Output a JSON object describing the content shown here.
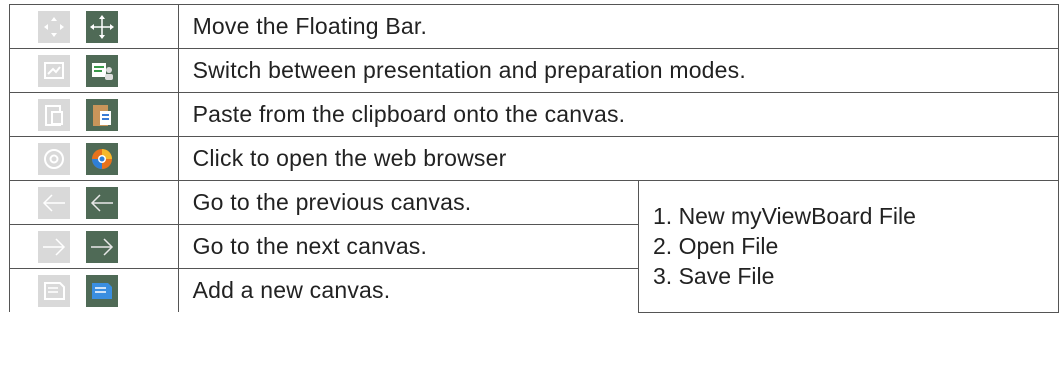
{
  "rows": [
    {
      "text": "Move the Floating Bar.",
      "icon_inactive": "move-icon-inactive",
      "icon_active": "move-icon-active"
    },
    {
      "text": "Switch between presentation and preparation modes.",
      "icon_inactive": "mode-switch-icon-inactive",
      "icon_active": "mode-switch-icon-active"
    },
    {
      "text": "Paste from the clipboard onto the canvas.",
      "icon_inactive": "paste-icon-inactive",
      "icon_active": "paste-icon-active"
    },
    {
      "text": "Click to open the web browser",
      "icon_inactive": "browser-icon-inactive",
      "icon_active": "browser-icon-active"
    },
    {
      "text": "Go to the previous canvas.",
      "icon_inactive": "arrow-left-icon-inactive",
      "icon_active": "arrow-left-icon-active"
    },
    {
      "text": "Go to the next canvas.",
      "icon_inactive": "arrow-right-icon-inactive",
      "icon_active": "arrow-right-icon-active"
    },
    {
      "text": "Add a new canvas.",
      "icon_inactive": "add-canvas-icon-inactive",
      "icon_active": "add-canvas-icon-active"
    }
  ],
  "side_list": [
    "1. New myViewBoard File",
    "2. Open File",
    "3. Save File"
  ],
  "colors": {
    "inactive_bg": "#d6d6d6",
    "active_bg": "#4e6b55",
    "border": "#555555"
  }
}
